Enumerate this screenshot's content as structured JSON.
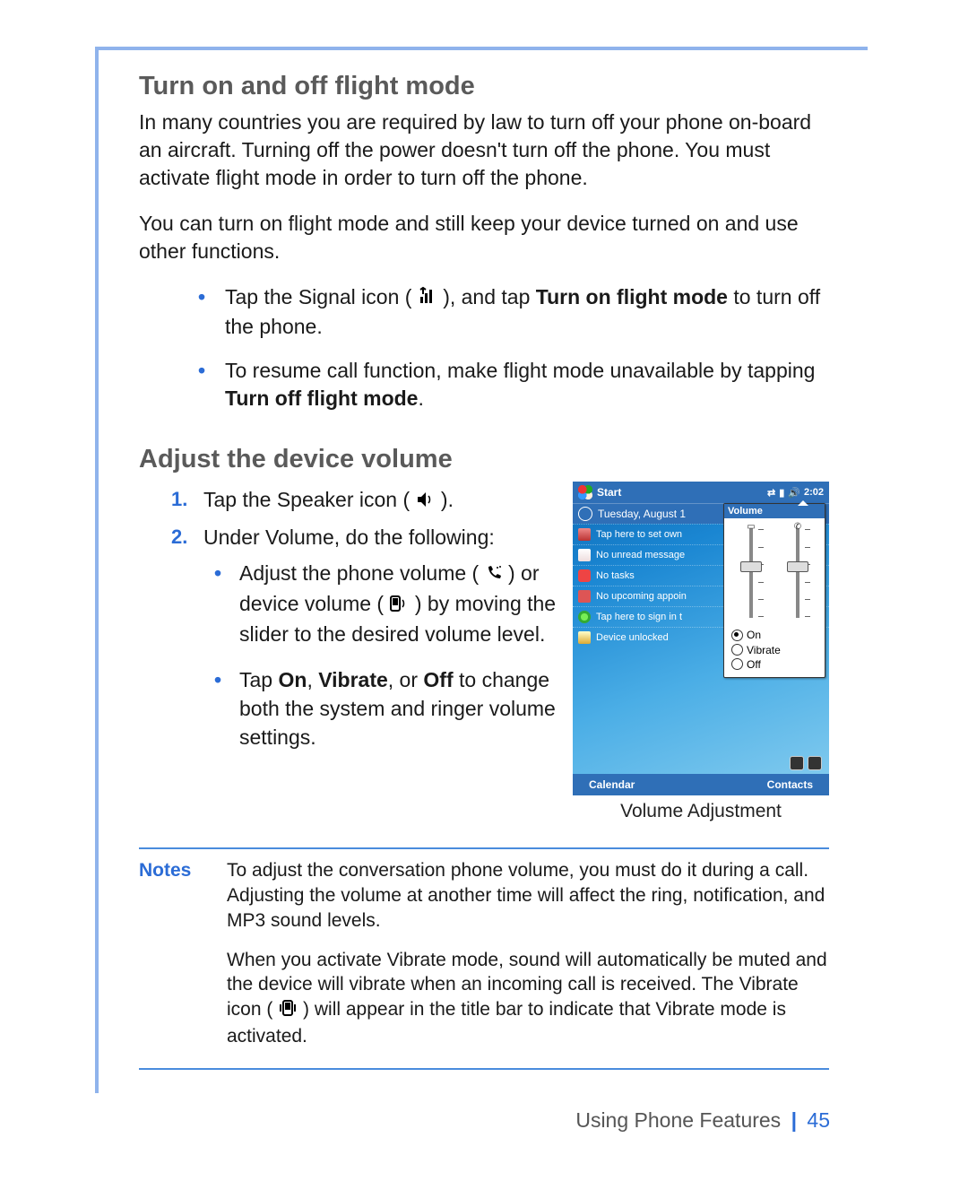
{
  "headings": {
    "flight": "Turn on and off flight mode",
    "volume": "Adjust the device volume"
  },
  "paragraphs": {
    "flight_p1": "In many countries you are required by law to turn off your phone on-board an aircraft. Turning off the power doesn't turn off the phone. You must activate flight mode in order to turn off the phone.",
    "flight_p2": "You can turn on flight mode and still keep your device turned on and use other functions."
  },
  "flight_bullets": {
    "b1_a": "Tap the Signal icon (",
    "b1_b": "), and tap ",
    "b1_bold": "Turn on flight mode",
    "b1_c": " to turn off the phone.",
    "b2_a": "To resume call function, make flight mode unavailable by tapping ",
    "b2_bold": "Turn off flight mode",
    "b2_b": "."
  },
  "vol_steps": {
    "s1_a": "Tap the Speaker icon (",
    "s1_b": ").",
    "s2": "Under Volume, do the following:",
    "s2b1_a": "Adjust the phone volume (",
    "s2b1_b": ") or device volume (",
    "s2b1_c": ") by moving the slider to the desired volume level.",
    "s2b2_a": "Tap ",
    "s2b2_on": "On",
    "s2b2_sep": ", ",
    "s2b2_vib": "Vibrate",
    "s2b2_or": ", or ",
    "s2b2_off": "Off",
    "s2b2_b": " to change both the system and ringer volume settings."
  },
  "caption": "Volume Adjustment",
  "notes": {
    "label": "Notes",
    "p1": "To adjust the conversation phone volume, you must do it during a call. Adjusting the volume at another time will affect the ring, notification, and MP3 sound levels.",
    "p2_a": "When you activate Vibrate mode, sound will automatically be muted and the device will vibrate when an incoming call is received. The Vibrate icon (",
    "p2_b": ") will appear in the title bar to indicate that Vibrate mode is activated."
  },
  "footer": {
    "section": "Using Phone Features",
    "page": "45"
  },
  "device": {
    "start": "Start",
    "clock": "2:02",
    "date": "Tuesday, August 1",
    "rows": {
      "owner": "Tap here to set own",
      "mail": "No unread message",
      "tasks": "No tasks",
      "cal": "No upcoming appoin",
      "msn": "Tap here to sign in t",
      "lock": "Device unlocked"
    },
    "softkeys": {
      "left": "Calendar",
      "right": "Contacts"
    },
    "volume": {
      "title": "Volume",
      "on": "On",
      "vibrate": "Vibrate",
      "off": "Off",
      "selected": "On"
    }
  }
}
